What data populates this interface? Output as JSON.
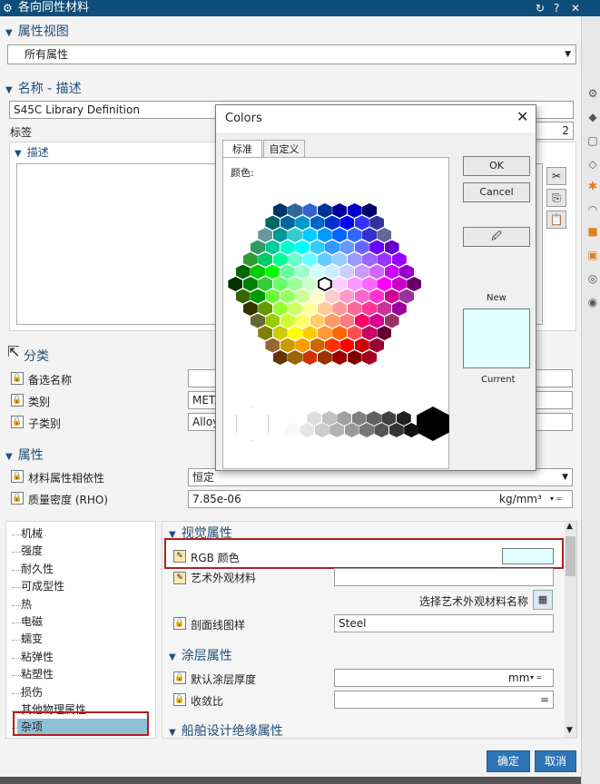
{
  "titlebar": {
    "title": "各向同性材料",
    "refresh_icon": "↻",
    "help_icon": "?",
    "close_icon": "✕"
  },
  "property_view": {
    "header": "属性视图",
    "select_value": "所有属性"
  },
  "name_desc": {
    "header": "名称 - 描述",
    "name_value": "S45C Library Definition",
    "tag_label": "标签",
    "tag_value": "2",
    "desc_header": "描述"
  },
  "classification": {
    "header": "分类",
    "rows": [
      {
        "label": "备选名称",
        "value": ""
      },
      {
        "label": "类别",
        "value": "METAL"
      },
      {
        "label": "子类别",
        "value": "Alloy"
      }
    ]
  },
  "properties": {
    "header": "属性",
    "rows": [
      {
        "label": "材料属性相依性",
        "value": "恒定"
      },
      {
        "label": "质量密度 (RHO)",
        "value": "7.85e-06",
        "unit": "kg/mm³"
      }
    ]
  },
  "categories": [
    "机械",
    "强度",
    "耐久性",
    "可成型性",
    "热",
    "电磁",
    "蠕变",
    "粘弹性",
    "粘塑性",
    "损伤",
    "其他物理属性",
    "杂项"
  ],
  "visual": {
    "header": "视觉属性",
    "rgb_label": "RGB 颜色",
    "rgb_color": "#e0ffff",
    "art_label": "艺术外观材料",
    "select_art": "选择艺术外观材料名称",
    "hatch_label": "剖面线图样",
    "hatch_value": "Steel"
  },
  "coating": {
    "header": "涂层属性",
    "thickness_label": "默认涂层厚度",
    "thickness_unit": "mm",
    "converge_label": "收敛比"
  },
  "ship": {
    "header": "船舶设计绝缘属性"
  },
  "footer": {
    "ok": "确定",
    "cancel": "取消"
  },
  "colors_dialog": {
    "title": "Colors",
    "close": "✕",
    "tabs": [
      "标准",
      "自定义"
    ],
    "colors_label": "颜色:",
    "ok": "OK",
    "cancel": "Cancel",
    "new_label": "New",
    "current_label": "Current",
    "new_color": "#e0ffff",
    "current_color": "#e0ffff",
    "hex_rows": [
      [
        "#003366",
        "#336699",
        "#3366cc",
        "#003399",
        "#000099",
        "#0000cc",
        "#000066"
      ],
      [
        "#006666",
        "#006699",
        "#0099cc",
        "#0066cc",
        "#0033cc",
        "#0000ff",
        "#3333ff",
        "#333399"
      ],
      [
        "#669999",
        "#009999",
        "#33cccc",
        "#00ccff",
        "#0099ff",
        "#0066ff",
        "#3366ff",
        "#3333cc",
        "#666699"
      ],
      [
        "#339966",
        "#00cc99",
        "#00ffcc",
        "#00ffff",
        "#33ccff",
        "#3399ff",
        "#6699ff",
        "#6666ff",
        "#6600ff",
        "#6600cc"
      ],
      [
        "#339933",
        "#00cc66",
        "#00ff99",
        "#66ffcc",
        "#66ffff",
        "#66ccff",
        "#99ccff",
        "#9999ff",
        "#9966ff",
        "#9933ff",
        "#9900ff"
      ],
      [
        "#006600",
        "#00cc00",
        "#00ff00",
        "#66ff99",
        "#99ffcc",
        "#ccffff",
        "#ccecff",
        "#ccccff",
        "#cc99ff",
        "#cc66ff",
        "#cc00ff",
        "#9900cc"
      ],
      [
        "#003300",
        "#008000",
        "#33cc33",
        "#66ff66",
        "#99ff99",
        "#ccffcc",
        "#ffffff",
        "#ffccff",
        "#ff99ff",
        "#ff66ff",
        "#ff00ff",
        "#cc00cc",
        "#660066"
      ],
      [
        "#336600",
        "#009900",
        "#66ff33",
        "#99ff66",
        "#ccff99",
        "#ffffcc",
        "#ffcccc",
        "#ff99cc",
        "#ff66cc",
        "#ff33cc",
        "#cc0099",
        "#993399"
      ],
      [
        "#333300",
        "#669900",
        "#99ff33",
        "#ccff66",
        "#ffff99",
        "#ffcc99",
        "#ff9999",
        "#ff6699",
        "#ff3399",
        "#cc3399",
        "#990099"
      ],
      [
        "#666633",
        "#99cc00",
        "#ccff33",
        "#ffff66",
        "#ffcc66",
        "#ff9966",
        "#ff7c80",
        "#ff0066",
        "#d60093",
        "#993366"
      ],
      [
        "#808000",
        "#cccc00",
        "#ffff00",
        "#ffcc00",
        "#ff9933",
        "#ff6600",
        "#ff5050",
        "#cc0066",
        "#660033"
      ],
      [
        "#996633",
        "#cc9900",
        "#ff9900",
        "#cc6600",
        "#ff3300",
        "#ff0000",
        "#cc0000",
        "#990033"
      ],
      [
        "#663300",
        "#996600",
        "#cc3300",
        "#993300",
        "#990000",
        "#800000",
        "#a50021"
      ]
    ],
    "gray_row1": [
      "#ffffff",
      "#dddddd",
      "#c0c0c0",
      "#a0a0a0",
      "#808080",
      "#606060",
      "#404040",
      "#202020"
    ],
    "gray_row2": [
      "#f8f8f8",
      "#e6e6e6",
      "#cccccc",
      "#b2b2b2",
      "#999999",
      "#777777",
      "#555555",
      "#333333",
      "#111111"
    ]
  }
}
